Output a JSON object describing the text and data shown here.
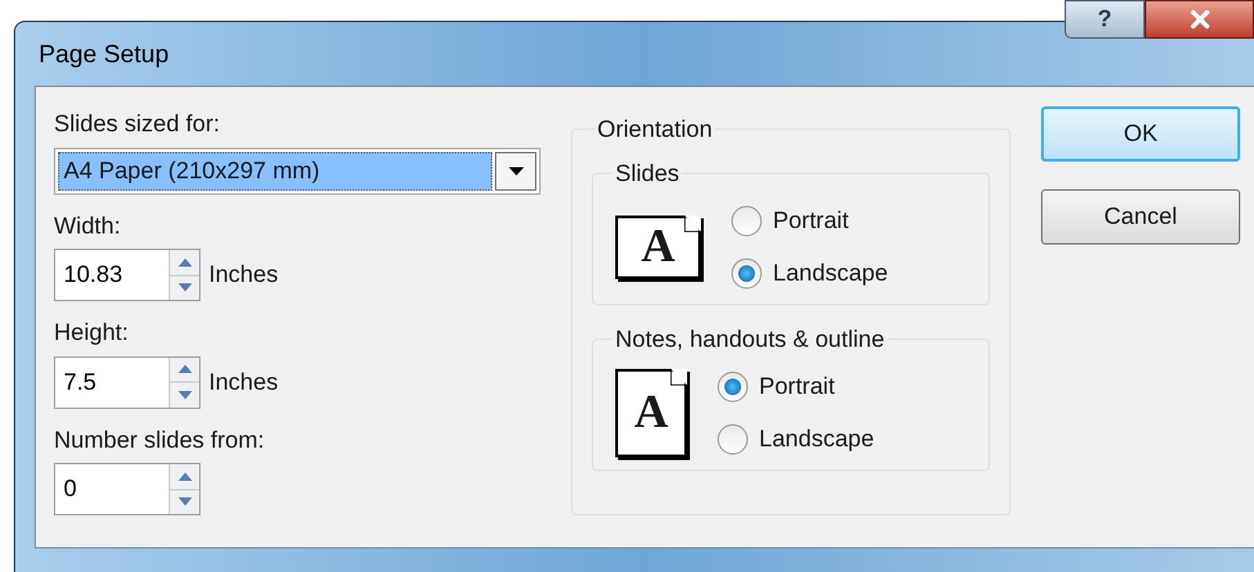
{
  "window": {
    "title": "Page Setup",
    "help_button": "?"
  },
  "slides_sized_for": {
    "label": "Slides sized for:",
    "value": "A4 Paper (210x297 mm)"
  },
  "fields": [
    {
      "label": "Width:",
      "value": "10.83",
      "unit": "Inches"
    },
    {
      "label": "Height:",
      "value": "7.5",
      "unit": "Inches"
    },
    {
      "label": "Number slides from:",
      "value": "0"
    }
  ],
  "orientation": {
    "title": "Orientation",
    "groups": [
      {
        "title": "Slides",
        "preview_letter": "A",
        "kind": "landscape",
        "options": [
          {
            "label": "Portrait",
            "selected": false
          },
          {
            "label": "Landscape",
            "selected": true
          }
        ]
      },
      {
        "title": "Notes, handouts & outline",
        "preview_letter": "A",
        "kind": "portrait",
        "options": [
          {
            "label": "Portrait",
            "selected": true
          },
          {
            "label": "Landscape",
            "selected": false
          }
        ]
      }
    ]
  },
  "buttons": [
    {
      "label": "OK",
      "default": true
    },
    {
      "label": "Cancel",
      "default": false
    }
  ]
}
